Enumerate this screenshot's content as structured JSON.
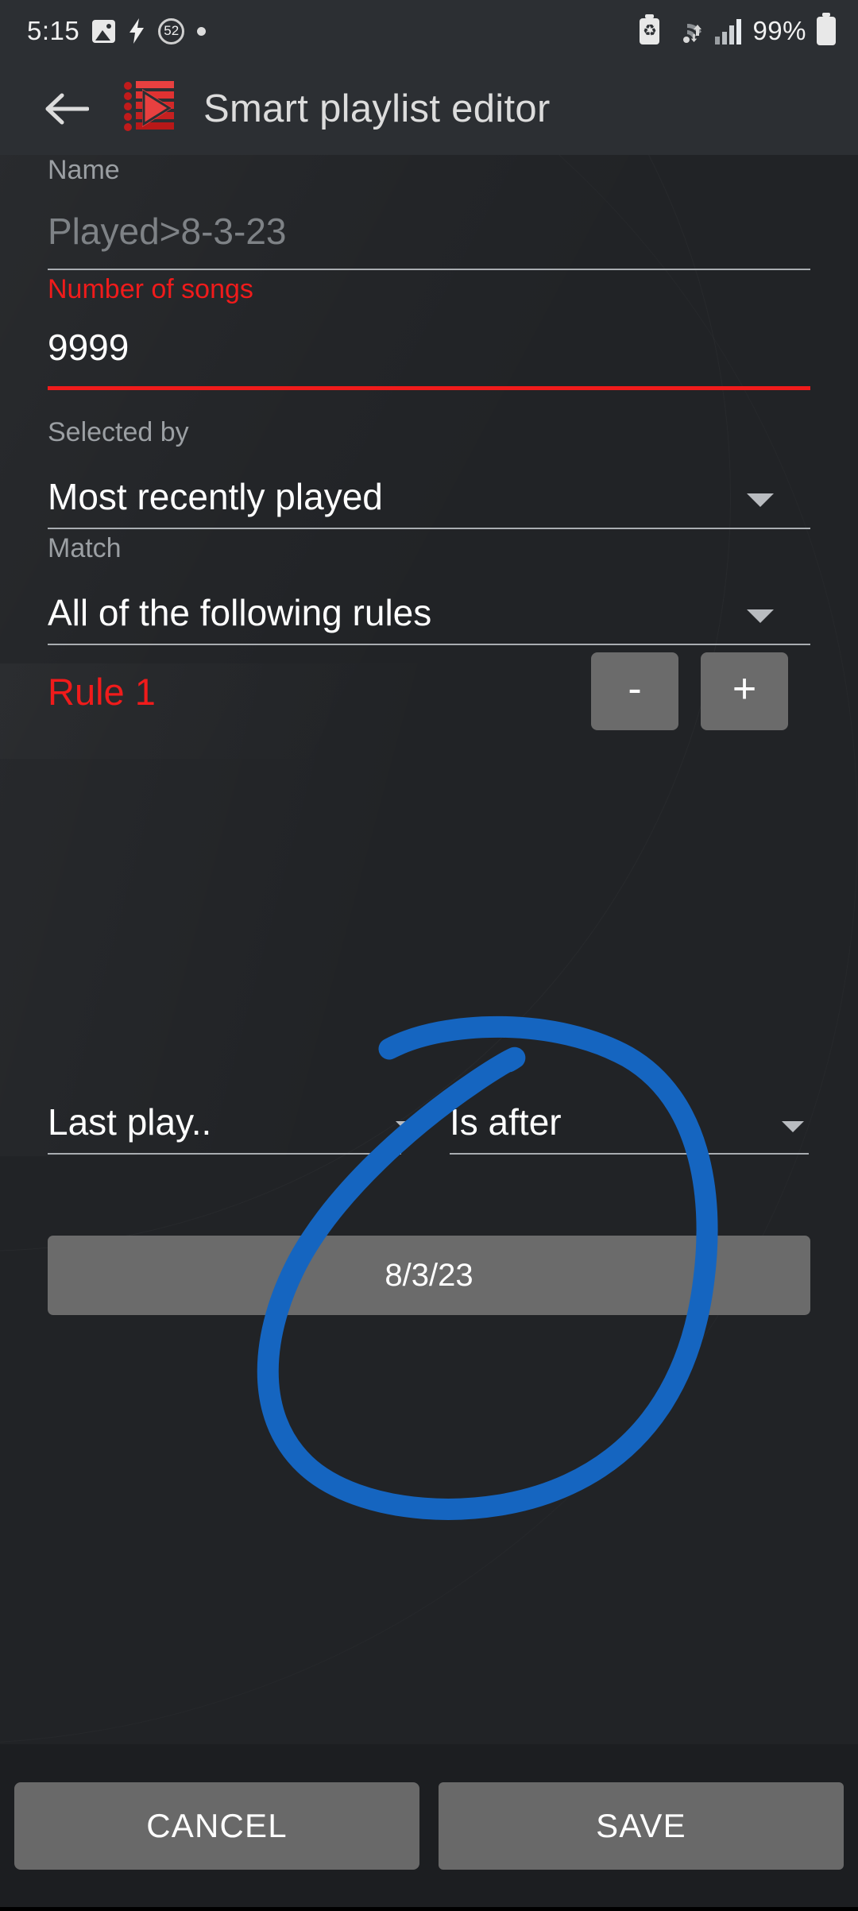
{
  "statusbar": {
    "time": "5:15",
    "battery_percent": "99%",
    "notification_count": "52",
    "icons": [
      "photo-icon",
      "charging-bolt-icon",
      "count-badge-icon",
      "dot-icon",
      "recycle-battery-icon",
      "wifi-icon",
      "signal-icon",
      "battery-icon"
    ]
  },
  "appbar": {
    "back_label": "←",
    "title": "Smart playlist editor",
    "logo_name": "playlist-play-icon"
  },
  "form": {
    "name": {
      "label": "Name",
      "value": "",
      "placeholder": "Played>8-3-23"
    },
    "number_of_songs": {
      "label": "Number of songs",
      "value": "9999",
      "error": true
    },
    "selected_by": {
      "label": "Selected by",
      "value": "Most recently played"
    },
    "match": {
      "label": "Match",
      "value": "All of the following rules"
    },
    "rule": {
      "title": "Rule 1",
      "minus_label": "-",
      "plus_label": "+",
      "field_value": "Last play..",
      "operator_value": "Is after",
      "date_value": "8/3/23"
    }
  },
  "bottombar": {
    "cancel_label": "CANCEL",
    "save_label": "SAVE"
  },
  "annotation": {
    "type": "hand-drawn-circle",
    "color": "#1565c0",
    "description": "blue circle drawn around the date field and rule operator"
  },
  "colors": {
    "accent_red": "#f01b1b",
    "annotation_blue": "#1565c0",
    "background": "#212326",
    "bar_background": "#2c2f33",
    "button_gray": "#6b6b6b"
  }
}
